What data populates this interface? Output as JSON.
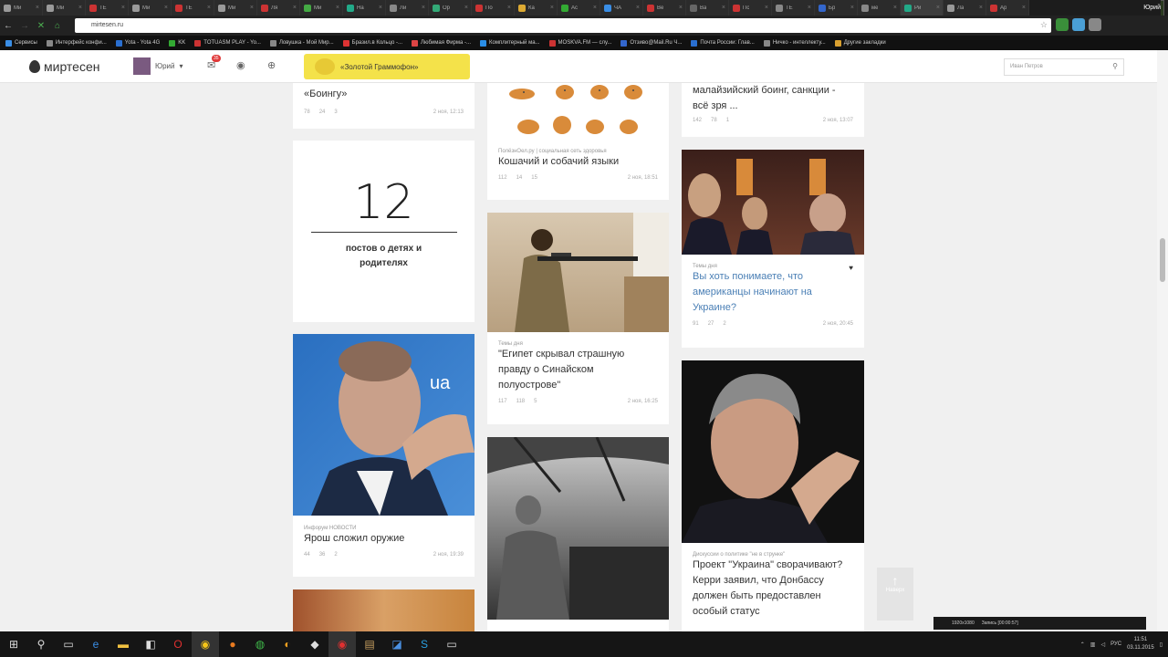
{
  "browser": {
    "tabs": [
      "Ми",
      "Ми",
      "ТЕ",
      "Ми",
      "ТЕ",
      "Ми",
      "Ля",
      "Ми",
      "На",
      "Ли",
      "Ор",
      "По",
      "Ка",
      "Ас",
      "ЧА",
      "Ве",
      "Ва",
      "Пс",
      "ТЕ",
      "Бр",
      "ме",
      "Ри",
      "Ла",
      "Ар"
    ],
    "user": "Юрий",
    "url": "mirtesen.ru",
    "bookmarks": [
      "Сервисы",
      "Интерфейс конфи...",
      "Yota - Yota 4G",
      "KK",
      "TOTUASM PLAY - Yo...",
      "Ловушка - Мой Мир...",
      "Бразил.в Кольцо -...",
      "Любимая Фирма -...",
      "Комплитерный ма...",
      "MOSKVA.FM — слу...",
      "Отзиво@Mail.Ru Ч...",
      "Почта России: Глав...",
      "Ничко - интеллекту...",
      "Другие закладки"
    ]
  },
  "header": {
    "logo": "миртесен",
    "user": "Юрий",
    "notif_count": "35",
    "promo": "«Золотой Граммофон»",
    "search_placeholder": "Иван Петров"
  },
  "col1": {
    "top": {
      "title": "«Боингу»",
      "stats": [
        "78",
        "24",
        "3"
      ],
      "date": "2 ноя, 12:13"
    },
    "counter": {
      "number": "12",
      "label": "постов о детях и родителях"
    },
    "yarosh": {
      "tag": "Инфорум НОВОСТИ",
      "title": "Ярош сложил оружие",
      "stats": [
        "44",
        "36",
        "2"
      ],
      "date": "2 ноя, 19:39"
    }
  },
  "col2": {
    "cats": {
      "tag": "ПолёзнОел.ру | социальная сеть здоровья",
      "title": "Кошачий и собачий языки",
      "stats": [
        "112",
        "14",
        "15"
      ],
      "date": "2 ноя, 18:51"
    },
    "egypt": {
      "tag": "Темы дня",
      "title": "\"Египет скрывал страшную правду о Синайском полуострове\"",
      "stats": [
        "117",
        "118",
        "5"
      ],
      "date": "2 ноя, 16:25"
    }
  },
  "col3": {
    "boeing": {
      "title": "малайзийский боинг, санкции - всё зря ...",
      "stats": [
        "142",
        "78",
        "1"
      ],
      "date": "2 ноя, 13:07"
    },
    "americans": {
      "tag": "Темы дня",
      "title": "Вы хоть понимаете, что американцы начинают на Украине?",
      "stats": [
        "91",
        "27",
        "2"
      ],
      "date": "2 ноя, 20:45"
    },
    "kerry": {
      "tag": "Дискуссии о политике \"не в струнке\"",
      "title": "Проект \"Украина\" сворачивают? Керри заявил, что Донбассу должен быть предоставлен особый статус"
    }
  },
  "up_label": "Наверх",
  "recorder": {
    "res": "1920x1080",
    "status": "Запись [00:00:57]"
  },
  "tray": {
    "lang": "РУС",
    "time": "11:51",
    "date": "03.11.2015"
  },
  "colors": {
    "link": "#4a7fb5",
    "promo": "#f4e24a",
    "badge": "#e03a3a"
  }
}
